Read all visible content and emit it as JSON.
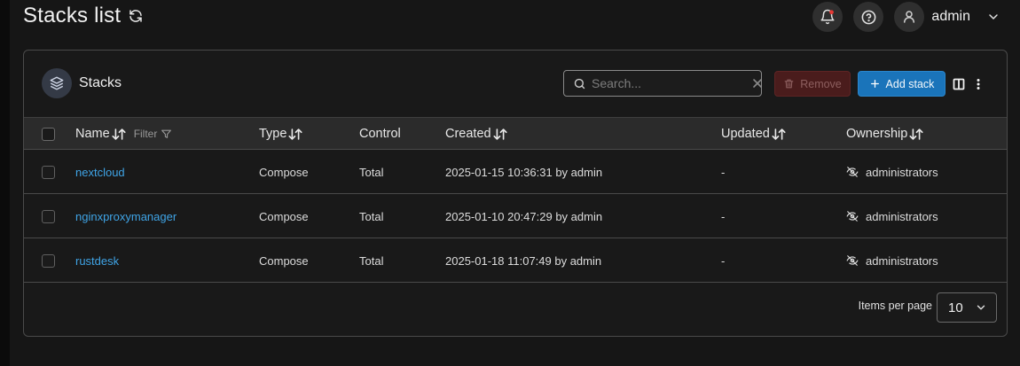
{
  "header": {
    "title": "Stacks list",
    "icons": {
      "refresh": "refresh-icon",
      "notifications": "bell-icon",
      "help": "help-icon",
      "user": "user-icon"
    },
    "notification_dot_color": "#e53935",
    "user_name": "admin"
  },
  "card": {
    "title": "Stacks",
    "icon": "stack-layers-icon",
    "search": {
      "placeholder": "Search...",
      "value": ""
    },
    "remove_label": "Remove",
    "add_label": "Add stack",
    "colors": {
      "add": "#1a74ba",
      "remove": "#4a1c1c"
    }
  },
  "table": {
    "columns": {
      "name": "Name",
      "filter": "Filter",
      "type": "Type",
      "control": "Control",
      "created": "Created",
      "updated": "Updated",
      "ownership": "Ownership"
    },
    "rows": [
      {
        "name": "nextcloud",
        "type": "Compose",
        "control": "Total",
        "created": "2025-01-15 10:36:31 by admin",
        "updated": "-",
        "ownership": "administrators"
      },
      {
        "name": "nginxproxymanager",
        "type": "Compose",
        "control": "Total",
        "created": "2025-01-10 20:47:29 by admin",
        "updated": "-",
        "ownership": "administrators"
      },
      {
        "name": "rustdesk",
        "type": "Compose",
        "control": "Total",
        "created": "2025-01-18 11:07:49 by admin",
        "updated": "-",
        "ownership": "administrators"
      }
    ],
    "link_color": "#3fa4e6"
  },
  "pagination": {
    "label": "Items per page",
    "value": "10"
  }
}
